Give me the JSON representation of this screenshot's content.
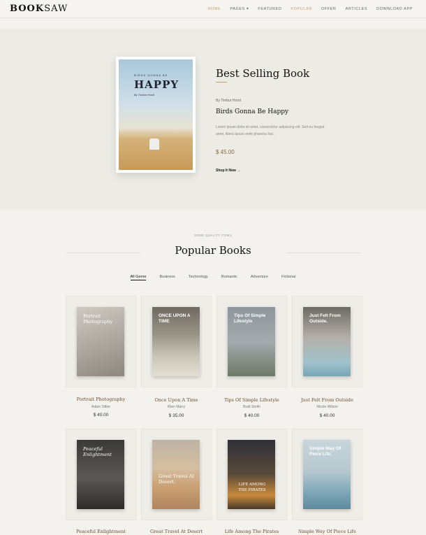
{
  "brand": {
    "logo_bold": "BOOK",
    "logo_light": "SAW"
  },
  "nav": [
    "HOME",
    "PAGES ▾",
    "FEATURED",
    "POPULAR",
    "OFFER",
    "ARTICLES",
    "DOWNLOAD APP"
  ],
  "hero": {
    "cover_small": "BIRDS GONNA BE",
    "cover_big": "HAPPY",
    "cover_author": "By Timbur Hood",
    "title": "Best Selling Book",
    "by": "By Timbur Hood",
    "name": "Birds Gonna Be Happy",
    "desc": "Lorem ipsum dolor sit amet, consectetur adipiscing elit. Sed eu feugiat amet, libero ipsum enim pharetra hac.",
    "price": "$ 45.00",
    "shop": "Shop It Now →"
  },
  "section": {
    "sub": "SOME QUALITY ITEMS",
    "title": "Popular Books"
  },
  "tabs": [
    "All Genre",
    "Business",
    "Technology",
    "Romantic",
    "Adventure",
    "Fictional"
  ],
  "books": [
    {
      "title": "Portrait Photography",
      "author": "Adam Silber",
      "price": "$ 40.00",
      "cover": "Portrait Photography"
    },
    {
      "title": "Once Upon A Time",
      "author": "Klien Marry",
      "price": "$ 35.00",
      "cover": "ONCE UPON A TIME"
    },
    {
      "title": "Tips Of Simple Lifestyle",
      "author": "Bratt Smith",
      "price": "$ 40.00",
      "cover": "Tips Of Simple Lifestyle"
    },
    {
      "title": "Just Felt From Outside",
      "author": "Nicole Wilson",
      "price": "$ 40.00",
      "cover": "Just Felt From Outside."
    },
    {
      "title": "Peaceful Enlightment",
      "cover": "Peaceful Enlightment"
    },
    {
      "title": "Great Travel At Desert",
      "cover": "Great Travel At Desert."
    },
    {
      "title": "Life Among The Pirates",
      "cover": "LIFE AMONG THE PIRATES"
    },
    {
      "title": "Simple Way Of Piece Life",
      "cover": "Simple Way Of Piece Life."
    }
  ],
  "colors": {
    "accent": "#c9a06a",
    "bg": "#f3f2ee",
    "hero_bg": "#ecebe5"
  }
}
